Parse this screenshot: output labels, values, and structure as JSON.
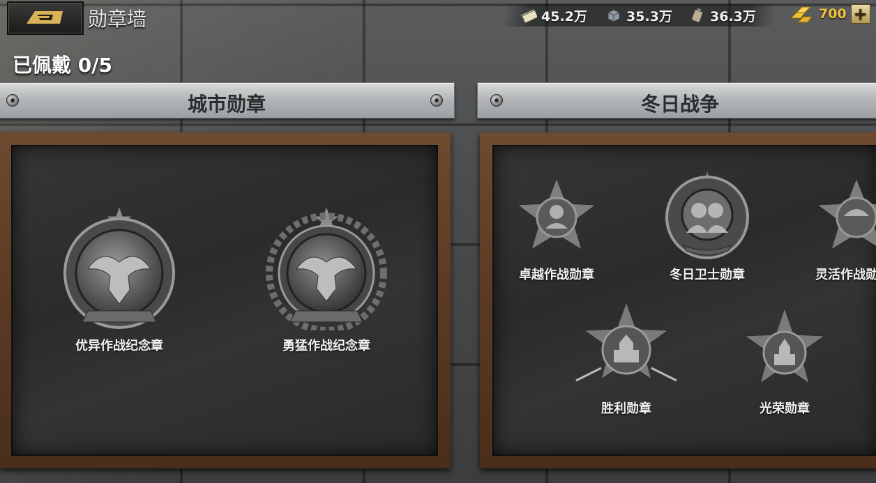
{
  "header": {
    "title": "勋章墙",
    "resources": [
      {
        "icon": "cash-icon",
        "value": "45.2万"
      },
      {
        "icon": "steel-icon",
        "value": "35.3万"
      },
      {
        "icon": "oil-icon",
        "value": "36.3万"
      }
    ],
    "gold": {
      "icon": "gold-bars-icon",
      "value": "700",
      "add_label": "+"
    }
  },
  "worn_label": "已佩戴 0/5",
  "sections": [
    {
      "title": "城市勋章",
      "medals": [
        {
          "label": "优异作战纪念章",
          "icon": "eagle-medal-icon"
        },
        {
          "label": "勇猛作战纪念章",
          "icon": "eagle-wreath-medal-icon"
        }
      ]
    },
    {
      "title": "冬日战争",
      "medals": [
        {
          "label": "卓越作战勋章",
          "icon": "star-soldier-medal-icon"
        },
        {
          "label": "冬日卫士勋章",
          "icon": "twin-soldiers-medal-icon"
        },
        {
          "label": "灵活作战勋",
          "icon": "star-helmet-medal-icon"
        },
        {
          "label": "胜利勋章",
          "icon": "victory-star-medal-icon"
        },
        {
          "label": "光荣勋章",
          "icon": "glory-star-medal-icon"
        }
      ]
    }
  ],
  "colors": {
    "gold_text": "#f2c23a",
    "board_wood": "#5a3a23",
    "board_inner": "#2b2b2b"
  }
}
